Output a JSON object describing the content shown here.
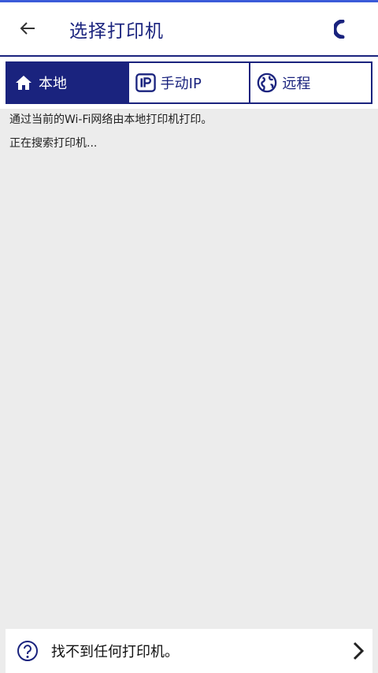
{
  "header": {
    "title": "选择打印机"
  },
  "tabs": [
    {
      "label": "本地",
      "icon": "home-icon",
      "active": true
    },
    {
      "label": "手动IP",
      "icon": "ip-icon",
      "active": false
    },
    {
      "label": "远程",
      "icon": "globe-icon",
      "active": false
    }
  ],
  "content": {
    "description": "通过当前的Wi-Fi网络由本地打印机打印。",
    "status": "正在搜索打印机..."
  },
  "footer": {
    "label": "找不到任何打印机。"
  },
  "colors": {
    "accent": "#1a237e",
    "background": "#ececec",
    "top_line": "#3b5bd9"
  }
}
